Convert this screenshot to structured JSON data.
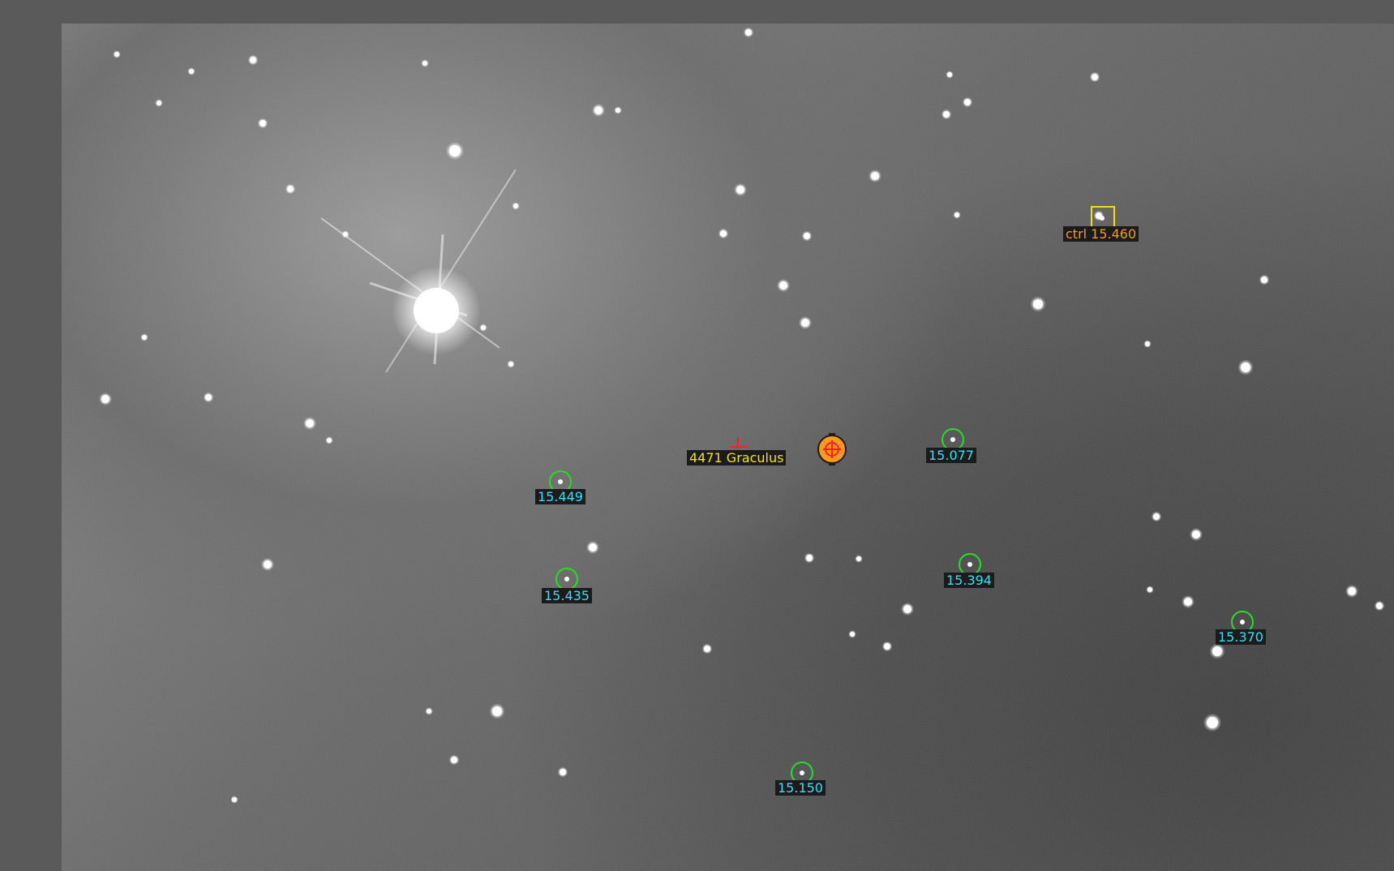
{
  "colors": {
    "comp_circle": "#22e022",
    "comp_label": "#2fe3ff",
    "check_box": "#f0e000",
    "check_label": "#ff9a1a",
    "target_label": "#f5e400",
    "target_marker": "#ff2020",
    "predicted_marker": "#ff9a1a"
  },
  "annotations": {
    "target_label": "4471 Graculus",
    "check_star_label": "ctrl 15.460",
    "comparison_stars": [
      {
        "label": "15.449"
      },
      {
        "label": "15.435"
      },
      {
        "label": "15.077"
      },
      {
        "label": "15.394"
      },
      {
        "label": "15.370"
      },
      {
        "label": "15.150"
      }
    ]
  },
  "icons": {
    "target_marker": "crosshair-tick-icon",
    "predicted_position": "target-reticle-icon"
  }
}
